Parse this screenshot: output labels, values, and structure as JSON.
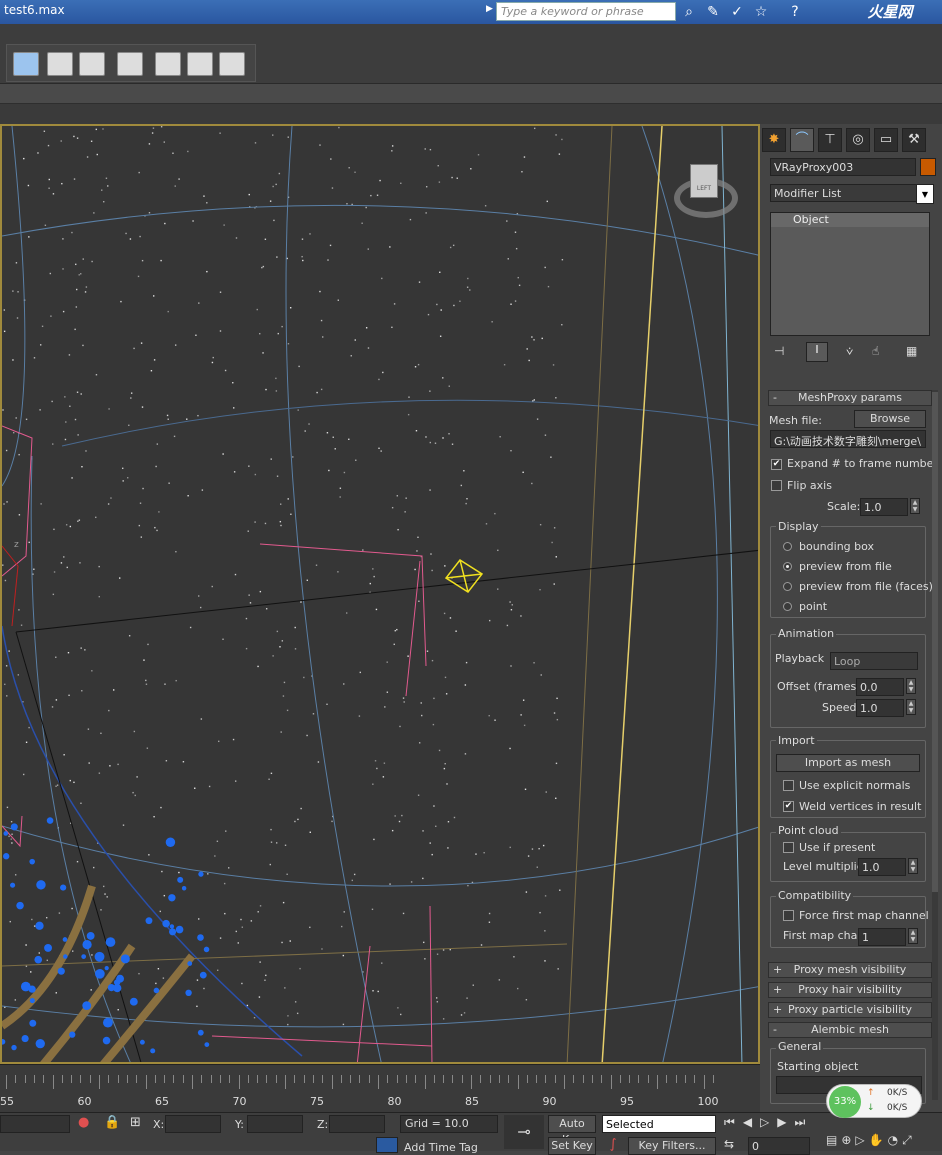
{
  "titlebar": {
    "title": "test6.max",
    "search_placeholder": "Type a keyword or phrase",
    "logo": "火星网"
  },
  "viewport": {
    "viewcube_label": "LEFT",
    "axis_label": "z"
  },
  "command_panel": {
    "object_name": "VRayProxy003",
    "object_color": "#c85a00",
    "modifier_list": "Modifier List",
    "stack_item": "Object",
    "meshproxy": {
      "title": "MeshProxy params",
      "mesh_file_label": "Mesh file:",
      "browse": "Browse",
      "path": "G:\\动画技术数字雕刻\\merge\\",
      "expand_label": "Expand # to frame number",
      "flip_label": "Flip axis",
      "scale_label": "Scale:",
      "scale_value": "1.0"
    },
    "display": {
      "title": "Display",
      "options": [
        "bounding box",
        "preview from file",
        "preview from file (faces)",
        "point"
      ],
      "selected": 1
    },
    "animation": {
      "title": "Animation",
      "playback_label": "Playback",
      "playback_value": "Loop",
      "offset_label": "Offset (frames)",
      "offset_value": "0.0",
      "speed_label": "Speed",
      "speed_value": "1.0"
    },
    "import": {
      "title": "Import",
      "button": "Import as mesh",
      "normals_label": "Use explicit normals",
      "weld_label": "Weld vertices in result"
    },
    "pointcloud": {
      "title": "Point cloud",
      "use_label": "Use if present",
      "level_label": "Level multiplier",
      "level_value": "1.0"
    },
    "compat": {
      "title": "Compatibility",
      "force_label": "Force first map channel",
      "first_label": "First map chan",
      "first_value": "1"
    },
    "rollouts": [
      {
        "sign": "+",
        "label": "Proxy mesh visibility"
      },
      {
        "sign": "+",
        "label": "Proxy hair visibility"
      },
      {
        "sign": "+",
        "label": "Proxy particle visibility"
      },
      {
        "sign": "-",
        "label": "Alembic mesh"
      }
    ],
    "alembic": {
      "general": "General",
      "starting_label": "Starting object"
    }
  },
  "timeline": {
    "ticks": [
      "55",
      "60",
      "65",
      "70",
      "75",
      "80",
      "85",
      "90",
      "95",
      "100"
    ]
  },
  "status": {
    "x_label": "X:",
    "y_label": "Y:",
    "z_label": "Z:",
    "grid": "Grid = 10.0",
    "auto_key": "Auto Key",
    "selected": "Selected",
    "set_key": "Set Key",
    "key_filters": "Key Filters...",
    "add_time_tag": "Add Time Tag",
    "frame_value": "0",
    "net_percent": "33%",
    "net_up": "0K/S",
    "net_down": "0K/S"
  }
}
